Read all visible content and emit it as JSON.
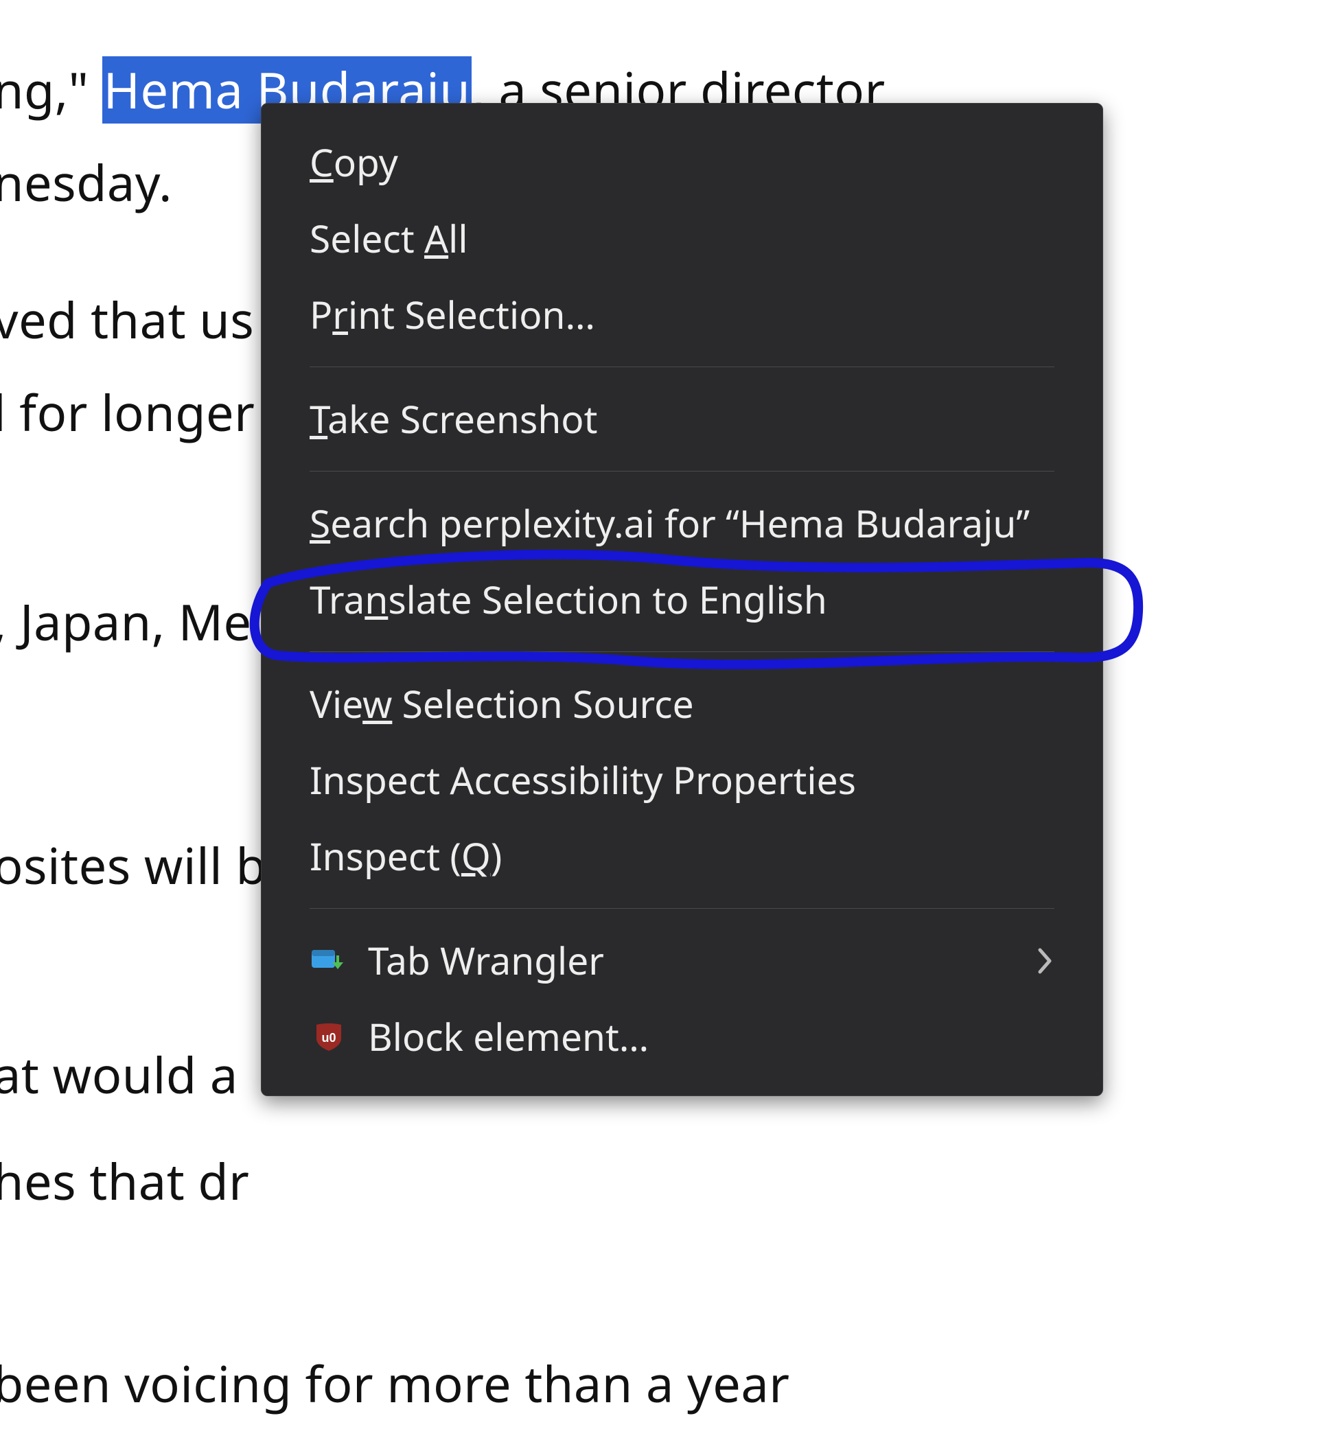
{
  "pageText": {
    "line1_pre": "ng,\" ",
    "line1_sel": "Hema Budaraju",
    "line1_post": ", a senior director",
    "line2": "nesday.",
    "line3": "ved that us",
    "line4": "l for longer",
    "line5": ", Japan, Me",
    "line6": "osites will b",
    "line7": "at would a",
    "line8": "hes that dr",
    "line9": "been voicing for more than a year"
  },
  "menu": {
    "copy": {
      "pre": "",
      "u": "C",
      "post": "opy"
    },
    "selectAll": {
      "pre": "Select ",
      "u": "A",
      "post": "ll"
    },
    "print": {
      "pre": "P",
      "u": "r",
      "post": "int Selection…"
    },
    "screenshot": {
      "pre": "",
      "u": "T",
      "post": "ake Screenshot"
    },
    "search": {
      "pre": "",
      "u": "S",
      "post": "earch perplexity.ai for “Hema Budaraju”"
    },
    "translate": {
      "pre": "Tra",
      "u": "n",
      "post": "slate Selection to English"
    },
    "viewSource": {
      "pre": "Vie",
      "u": "w",
      "post": " Selection Source"
    },
    "a11y": {
      "pre": "Inspect Accessibility Properties",
      "u": "",
      "post": ""
    },
    "inspect": {
      "pre": "Inspect (",
      "u": "Q",
      "post": ")"
    },
    "tabWrangler": "Tab Wrangler",
    "blockElement": "Block element…"
  },
  "annotation": {
    "color": "#1616d4"
  }
}
